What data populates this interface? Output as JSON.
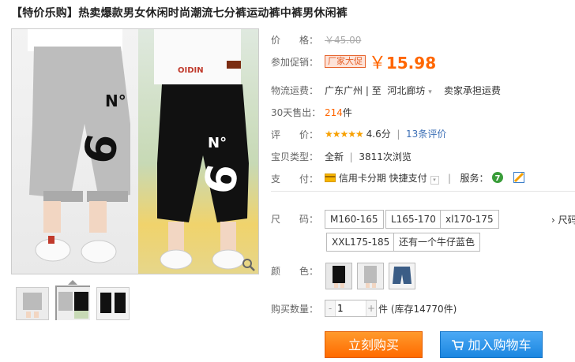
{
  "title": "【特价乐购】热卖爆款男女休闲时尚潮流七分裤运动裤中裤男休闲裤",
  "price": {
    "label": "价　　格：",
    "original": "￥45.00"
  },
  "promo": {
    "label": "参加促销：",
    "tag": "厂家大促",
    "yen": "￥",
    "value": "15.98"
  },
  "shipping": {
    "label": "物流运费：",
    "from": "广东广州",
    "to_prefix": "至",
    "to": "河北廊坊",
    "caret": "▾",
    "fee": "卖家承担运费"
  },
  "sales": {
    "label": "30天售出：",
    "count": "214",
    "unit": "件"
  },
  "rating": {
    "label": "评　　价：",
    "stars": "★★★★★",
    "score": "4.6分",
    "sep": "|",
    "reviews": "13条评价"
  },
  "type": {
    "label": "宝贝类型：",
    "value": "全新",
    "sep": "|",
    "views": "3811次浏览"
  },
  "payment": {
    "label": "支　　付：",
    "credit": "信用卡分期",
    "quick": "快捷支付",
    "service_label": "服务："
  },
  "size": {
    "label": "尺　　码：",
    "options": [
      "M160-165",
      "L165-170",
      "xl170-175",
      "XXL175-185",
      "还有一个牛仔蓝色"
    ],
    "more": "› 尺码"
  },
  "color": {
    "label": "颜　　色："
  },
  "quantity": {
    "label": "购买数量：",
    "value": "1",
    "minus": "-",
    "plus": "+",
    "stock": "件 (库存14770件)"
  },
  "buttons": {
    "buy_now": "立刻购买",
    "add_cart": "加入购物车",
    "cart_icon": "cart-icon"
  }
}
